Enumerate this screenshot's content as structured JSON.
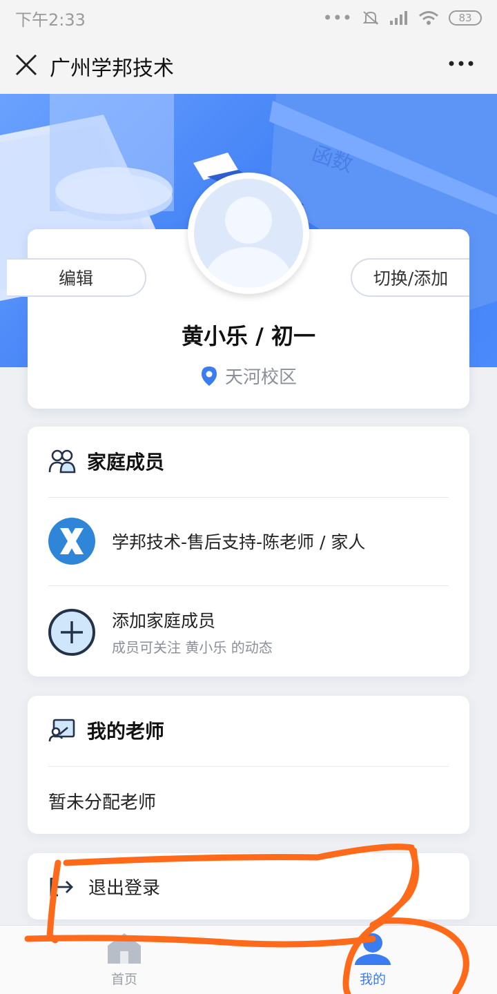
{
  "status_bar": {
    "time": "下午2:33",
    "battery": "83"
  },
  "nav": {
    "title": "广州学邦技术"
  },
  "banner": {
    "book_text": "函数"
  },
  "profile": {
    "edit_label": "编辑",
    "switch_label": "切换/添加",
    "name": "黄小乐 / 初一",
    "campus": "天河校区"
  },
  "family": {
    "title": "家庭成员",
    "member_name": "学邦技术-售后支持-陈老师 / 家人",
    "add_title": "添加家庭成员",
    "add_subtitle": "成员可关注 黄小乐 的动态"
  },
  "teacher": {
    "title": "我的老师",
    "empty_text": "暂未分配老师"
  },
  "logout": {
    "label": "退出登录"
  },
  "tabbar": {
    "home_label": "首页",
    "mine_label": "我的"
  },
  "colors": {
    "accent": "#3b7cf0",
    "annotation": "#ff6a1a"
  }
}
